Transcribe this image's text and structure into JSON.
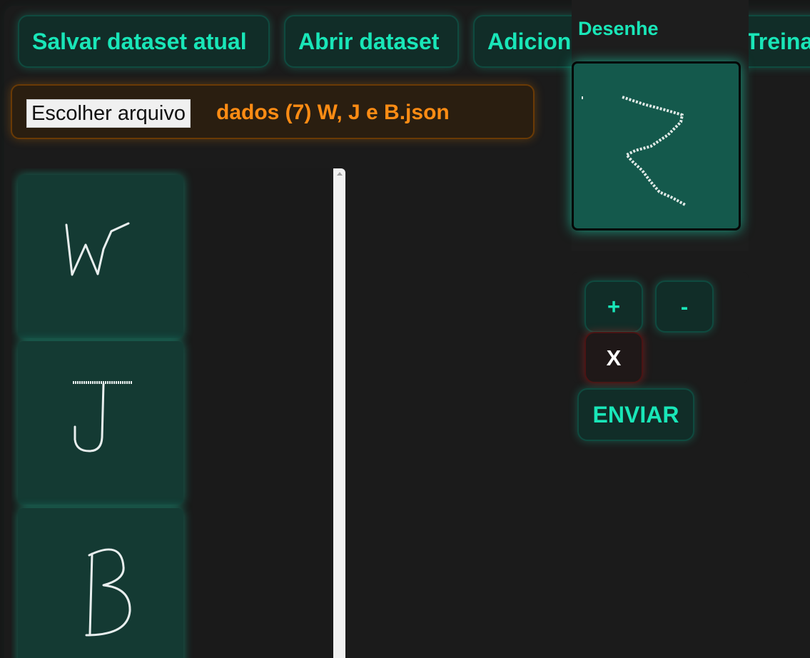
{
  "toolbar": {
    "save_label": "Salvar dataset atual",
    "open_label": "Abrir dataset",
    "add_label": "Adicionar desenho",
    "train_label": "Treinar"
  },
  "file_input": {
    "button_label": "Escolher arquivo",
    "file_name": "dados (7) W, J e B.json"
  },
  "gallery": {
    "items": [
      {
        "letter": "W"
      },
      {
        "letter": "J"
      },
      {
        "letter": "B"
      }
    ]
  },
  "draw_panel": {
    "title": "Desenhe",
    "canvas_content": "Z"
  },
  "controls": {
    "increase_label": "+",
    "decrease_label": "-",
    "clear_label": "X"
  },
  "submit": {
    "label": "ENVIAR"
  },
  "colors": {
    "accent": "#19e6b8",
    "panel": "#112d28",
    "file_accent": "#ff8c14",
    "background": "#171717",
    "canvas_bg": "#14594c"
  }
}
